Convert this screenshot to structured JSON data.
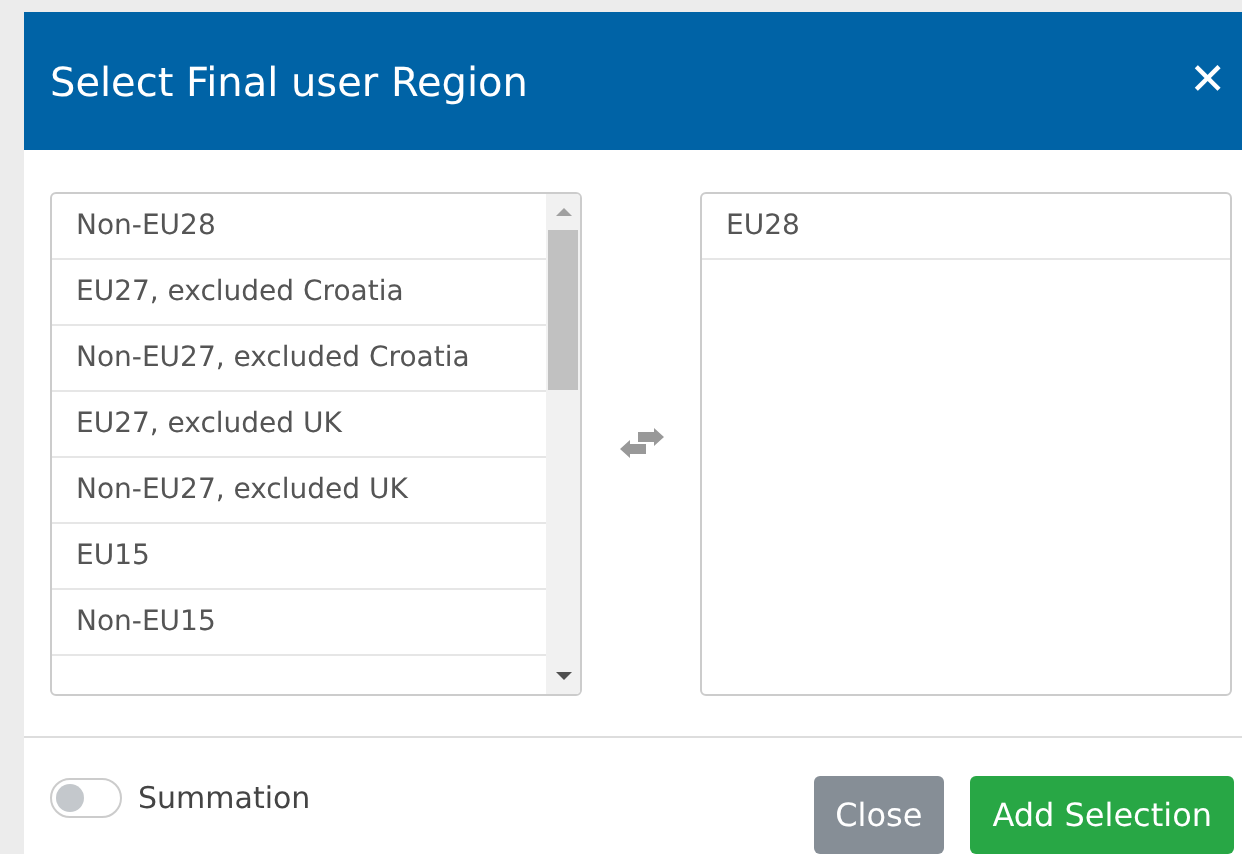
{
  "dialog": {
    "title": "Select Final user Region",
    "close_glyph": "✕"
  },
  "available": [
    {
      "label": "Non-EU28"
    },
    {
      "label": "EU27, excluded Croatia"
    },
    {
      "label": "Non-EU27, excluded Croatia"
    },
    {
      "label": "EU27, excluded UK"
    },
    {
      "label": "Non-EU27, excluded UK"
    },
    {
      "label": "EU15"
    },
    {
      "label": "Non-EU15"
    }
  ],
  "selected_items": [
    {
      "label": "EU28"
    }
  ],
  "summation": {
    "label": "Summation",
    "on": false
  },
  "buttons": [
    {
      "label": "Close",
      "kind": "secondary"
    },
    {
      "label": "Add Selection",
      "kind": "primary"
    }
  ]
}
